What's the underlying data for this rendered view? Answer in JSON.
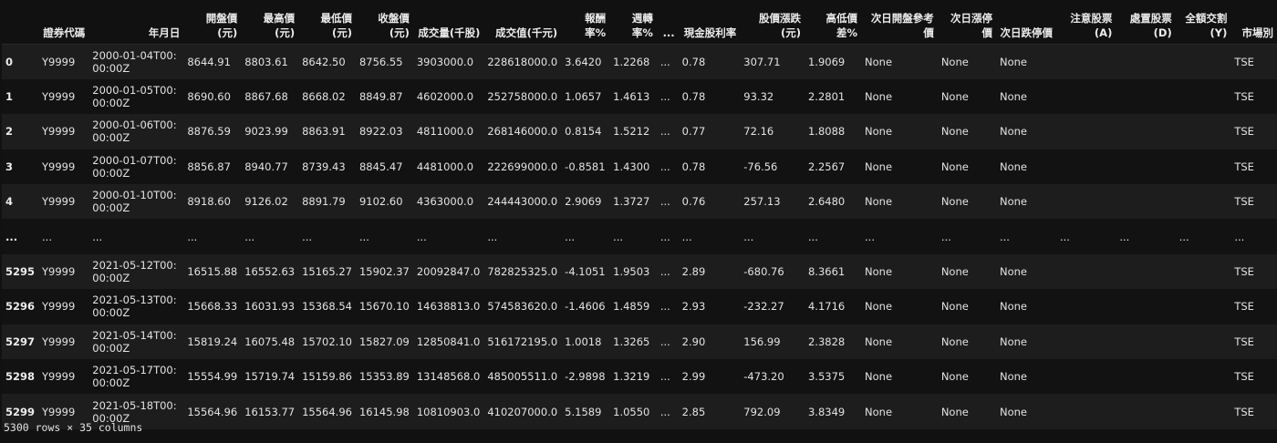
{
  "dataframe": {
    "columns": [
      "證券代碼",
      "年月日",
      "開盤價(元)",
      "最高價(元)",
      "最低價(元)",
      "收盤價(元)",
      "成交量(千股)",
      "成交值(千元)",
      "報酬率%",
      "週轉率%",
      "...",
      "現金股利率",
      "股價漲跌(元)",
      "高低價差%",
      "次日開盤參考價",
      "次日漲停價",
      "次日跌停價",
      "注意股票(A)",
      "處置股票(D)",
      "全額交割(Y)",
      "市場別"
    ],
    "rows": [
      {
        "index": "0",
        "cells": [
          "Y9999",
          "2000-01-04T00:00:00Z",
          "8644.91",
          "8803.61",
          "8642.50",
          "8756.55",
          "3903000.0",
          "228618000.0",
          "3.6420",
          "1.2268",
          "...",
          "0.78",
          "307.71",
          "1.9069",
          "None",
          "None",
          "None",
          "",
          "",
          "",
          "TSE"
        ]
      },
      {
        "index": "1",
        "cells": [
          "Y9999",
          "2000-01-05T00:00:00Z",
          "8690.60",
          "8867.68",
          "8668.02",
          "8849.87",
          "4602000.0",
          "252758000.0",
          "1.0657",
          "1.4613",
          "...",
          "0.78",
          "93.32",
          "2.2801",
          "None",
          "None",
          "None",
          "",
          "",
          "",
          "TSE"
        ]
      },
      {
        "index": "2",
        "cells": [
          "Y9999",
          "2000-01-06T00:00:00Z",
          "8876.59",
          "9023.99",
          "8863.91",
          "8922.03",
          "4811000.0",
          "268146000.0",
          "0.8154",
          "1.5212",
          "...",
          "0.77",
          "72.16",
          "1.8088",
          "None",
          "None",
          "None",
          "",
          "",
          "",
          "TSE"
        ]
      },
      {
        "index": "3",
        "cells": [
          "Y9999",
          "2000-01-07T00:00:00Z",
          "8856.87",
          "8940.77",
          "8739.43",
          "8845.47",
          "4481000.0",
          "222699000.0",
          "-0.8581",
          "1.4300",
          "...",
          "0.78",
          "-76.56",
          "2.2567",
          "None",
          "None",
          "None",
          "",
          "",
          "",
          "TSE"
        ]
      },
      {
        "index": "4",
        "cells": [
          "Y9999",
          "2000-01-10T00:00:00Z",
          "8918.60",
          "9126.02",
          "8891.79",
          "9102.60",
          "4363000.0",
          "244443000.0",
          "2.9069",
          "1.3727",
          "...",
          "0.76",
          "257.13",
          "2.6480",
          "None",
          "None",
          "None",
          "",
          "",
          "",
          "TSE"
        ]
      },
      {
        "index": "...",
        "cells": [
          "...",
          "...",
          "...",
          "...",
          "...",
          "...",
          "...",
          "...",
          "...",
          "...",
          "...",
          "...",
          "...",
          "...",
          "...",
          "...",
          "...",
          "...",
          "...",
          "...",
          "..."
        ]
      },
      {
        "index": "5295",
        "cells": [
          "Y9999",
          "2021-05-12T00:00:00Z",
          "16515.88",
          "16552.63",
          "15165.27",
          "15902.37",
          "20092847.0",
          "782825325.0",
          "-4.1051",
          "1.9503",
          "...",
          "2.89",
          "-680.76",
          "8.3661",
          "None",
          "None",
          "None",
          "",
          "",
          "",
          "TSE"
        ]
      },
      {
        "index": "5296",
        "cells": [
          "Y9999",
          "2021-05-13T00:00:00Z",
          "15668.33",
          "16031.93",
          "15368.54",
          "15670.10",
          "14638813.0",
          "574583620.0",
          "-1.4606",
          "1.4859",
          "...",
          "2.93",
          "-232.27",
          "4.1716",
          "None",
          "None",
          "None",
          "",
          "",
          "",
          "TSE"
        ]
      },
      {
        "index": "5297",
        "cells": [
          "Y9999",
          "2021-05-14T00:00:00Z",
          "15819.24",
          "16075.48",
          "15702.10",
          "15827.09",
          "12850841.0",
          "516172195.0",
          "1.0018",
          "1.3265",
          "...",
          "2.90",
          "156.99",
          "2.3828",
          "None",
          "None",
          "None",
          "",
          "",
          "",
          "TSE"
        ]
      },
      {
        "index": "5298",
        "cells": [
          "Y9999",
          "2021-05-17T00:00:00Z",
          "15554.99",
          "15719.74",
          "15159.86",
          "15353.89",
          "13148568.0",
          "485005511.0",
          "-2.9898",
          "1.3219",
          "...",
          "2.99",
          "-473.20",
          "3.5375",
          "None",
          "None",
          "None",
          "",
          "",
          "",
          "TSE"
        ]
      },
      {
        "index": "5299",
        "cells": [
          "Y9999",
          "2021-05-18T00:00:00Z",
          "15564.96",
          "16153.77",
          "15564.96",
          "16145.98",
          "10810903.0",
          "410207000.0",
          "5.1589",
          "1.0550",
          "...",
          "2.85",
          "792.09",
          "3.8349",
          "None",
          "None",
          "None",
          "",
          "",
          "",
          "TSE"
        ]
      }
    ],
    "shape_text": "5300 rows × 35 columns"
  }
}
